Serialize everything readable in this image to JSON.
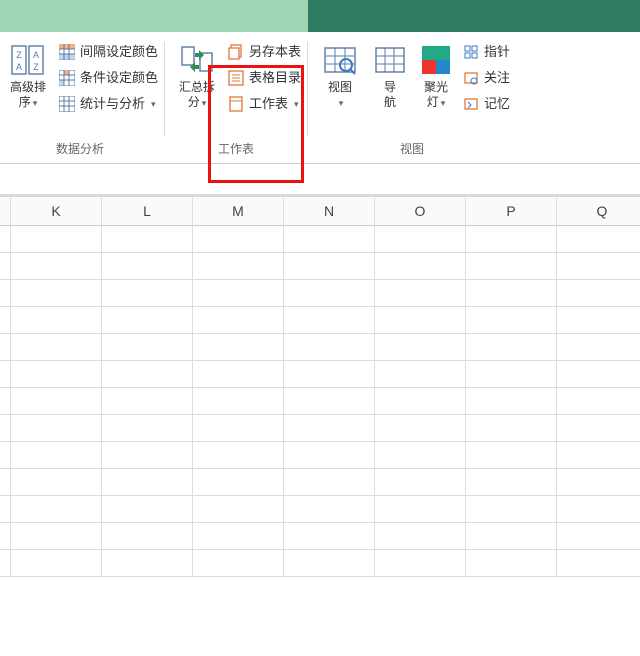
{
  "ribbon": {
    "dataAnalysis": {
      "groupLabel": "数据分析",
      "sort": {
        "line1": "高级排",
        "line2": "序"
      },
      "intervalColor": "间隔设定颜色",
      "conditionalColor": "条件设定颜色",
      "stats": "统计与分析"
    },
    "worksheet": {
      "groupLabel": "工作表",
      "summarySplit": {
        "line1": "汇总拆",
        "line2": "分"
      },
      "saveCopy": "另存本表",
      "toc": "表格目录",
      "worksheetMenu": "工作表"
    },
    "view": {
      "groupLabel": "视图",
      "viewBtn": "视图",
      "nav": {
        "line1": "导",
        "line2": "航"
      },
      "spotlight": {
        "line1": "聚光",
        "line2": "灯"
      },
      "pointer": "指针",
      "follow": "关注",
      "memory": "记忆"
    }
  },
  "grid": {
    "cols": [
      "K",
      "L",
      "M",
      "N",
      "O",
      "P",
      "Q"
    ],
    "rowCount": 13
  }
}
